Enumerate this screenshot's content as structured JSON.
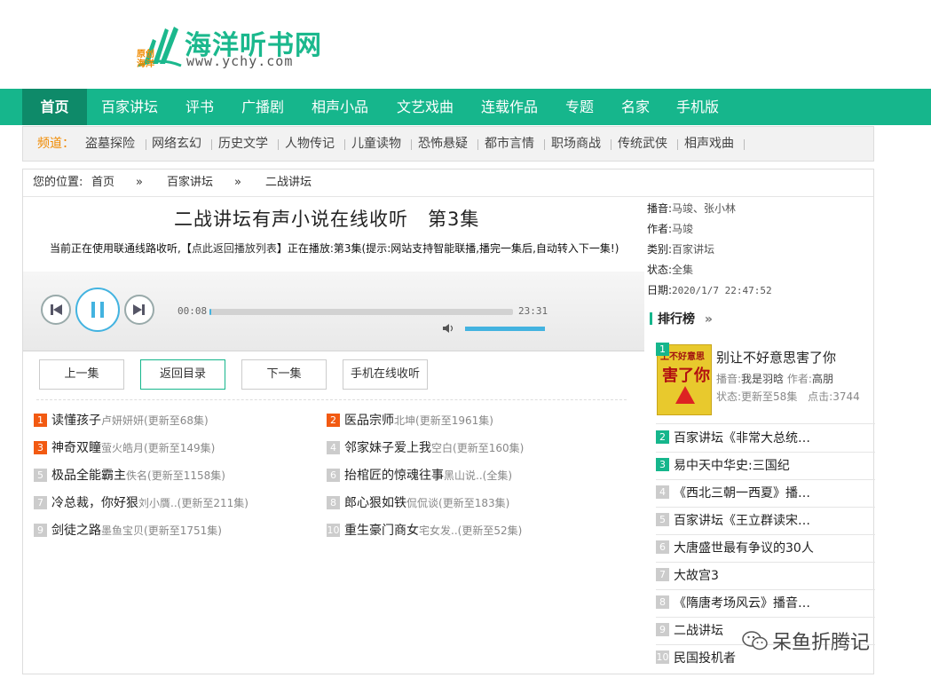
{
  "logo": {
    "cn": "海洋听书网",
    "url": "www.ychy.com",
    "tag1": "原创",
    "tag2": "海洋"
  },
  "nav": [
    {
      "label": "首页",
      "active": true
    },
    {
      "label": "百家讲坛"
    },
    {
      "label": "评书"
    },
    {
      "label": "广播剧"
    },
    {
      "label": "相声小品"
    },
    {
      "label": "文艺戏曲"
    },
    {
      "label": "连载作品"
    },
    {
      "label": "专题"
    },
    {
      "label": "名家"
    },
    {
      "label": "手机版"
    }
  ],
  "channels": {
    "label": "频道：",
    "items": [
      "盗墓探险",
      "网络玄幻",
      "历史文学",
      "人物传记",
      "儿童读物",
      "恐怖悬疑",
      "都市言情",
      "职场商战",
      "传统武侠",
      "相声戏曲"
    ]
  },
  "breadcrumb": {
    "prefix": "您的位置:",
    "home": "首页",
    "sep": "»",
    "cat": "百家讲坛",
    "current": "二战讲坛"
  },
  "title": "二战讲坛有声小说在线收听　第3集",
  "notice": {
    "part1": "当前正在使用联通线路收听,【",
    "link": "点此返回播放列表",
    "part2": "】正在播放:第3集(提示:网站支持智能联播,播完一集后,自动转入下一集!)"
  },
  "player": {
    "current": "00:08",
    "total": "23:31",
    "progress": 0.006,
    "volume": 1.0
  },
  "actions": {
    "prev": "上一集",
    "back": "返回目录",
    "next": "下一集",
    "mobile": "手机在线收听"
  },
  "related": [
    {
      "n": "1",
      "title": "读懂孩子",
      "author": "卢妍妍妍",
      "upd": "(更新至68集)"
    },
    {
      "n": "2",
      "title": "医品宗师",
      "author": "北坤",
      "upd": "(更新至1961集)"
    },
    {
      "n": "3",
      "title": "神奇双瞳",
      "author": "萤火皓月",
      "upd": "(更新至149集)"
    },
    {
      "n": "4",
      "title": "邻家妹子爱上我",
      "author": "空白",
      "upd": "(更新至160集)"
    },
    {
      "n": "5",
      "title": "极品全能霸主",
      "author": "佚名",
      "upd": "(更新至1158集)"
    },
    {
      "n": "6",
      "title": "抬棺匠的惊魂往事",
      "author": "黑山说..",
      "upd": "(全集)"
    },
    {
      "n": "7",
      "title": "冷总裁，你好狠",
      "author": "刘小贋..",
      "upd": "(更新至211集)"
    },
    {
      "n": "8",
      "title": "郎心狠如铁",
      "author": "侃侃谈",
      "upd": "(更新至183集)"
    },
    {
      "n": "9",
      "title": "剑徒之路",
      "author": "墨鱼宝贝",
      "upd": "(更新至1751集)"
    },
    {
      "n": "10",
      "title": "重生豪门商女",
      "author": "宅女发..",
      "upd": "(更新至52集)"
    }
  ],
  "info": {
    "anchor_k": "播音:",
    "anchor_v": "马竣、张小林",
    "writer_k": "作者:",
    "writer_v": "马竣",
    "cat_k": "类别:",
    "cat_v": "百家讲坛",
    "state_k": "状态:",
    "state_v": "全集",
    "date_k": "日期:",
    "date_v": "2020/1/7 22:47:52"
  },
  "rank": {
    "head": "排行榜",
    "arrow": "»",
    "top": {
      "n": "1",
      "title": "别让不好意思害了你",
      "anchor_k": "播音:",
      "anchor_v": "我是羽晗",
      "writer_k": "作者:",
      "writer_v": "高朋",
      "state_k": "状态:",
      "state_v": "更新至58集",
      "clicks": "点击:3744",
      "cover_t1": "上不好意思",
      "cover_t2": "害了你"
    },
    "items": [
      {
        "n": "2",
        "title": "百家讲坛《非常大总统…"
      },
      {
        "n": "3",
        "title": "易中天中华史:三国纪"
      },
      {
        "n": "4",
        "title": "《西北三朝一西夏》播…"
      },
      {
        "n": "5",
        "title": "百家讲坛《王立群读宋…"
      },
      {
        "n": "6",
        "title": "大唐盛世最有争议的30人"
      },
      {
        "n": "7",
        "title": "大故宫3"
      },
      {
        "n": "8",
        "title": "《隋唐考场风云》播音…"
      },
      {
        "n": "9",
        "title": "二战讲坛"
      },
      {
        "n": "10",
        "title": "民国投机者"
      }
    ]
  },
  "watermark": "呆鱼折腾记"
}
